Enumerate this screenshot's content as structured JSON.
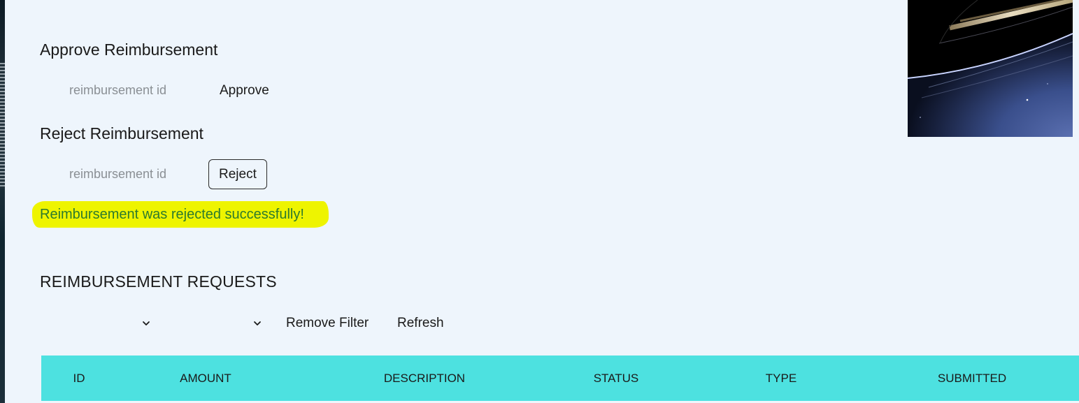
{
  "approve": {
    "title": "Approve Reimbursement",
    "placeholder": "reimbursement id",
    "button_label": "Approve"
  },
  "reject": {
    "title": "Reject Reimbursement",
    "placeholder": "reimbursement id",
    "button_label": "Reject"
  },
  "status_message": "Reimbursement was rejected successfully!",
  "requests": {
    "title": "REIMBURSEMENT REQUESTS",
    "filter1_value": "",
    "filter2_value": "",
    "remove_filter_label": "Remove Filter",
    "refresh_label": "Refresh",
    "columns": [
      "ID",
      "AMOUNT",
      "DESCRIPTION",
      "STATUS",
      "TYPE",
      "SUBMITTED"
    ]
  },
  "colors": {
    "page_bg": "#eef5fc",
    "table_header_bg": "#4de1e0",
    "success_text": "#2d7a2e",
    "highlight": "#eef400"
  },
  "decor": {
    "photo_icon": "saturn-rings-image"
  }
}
